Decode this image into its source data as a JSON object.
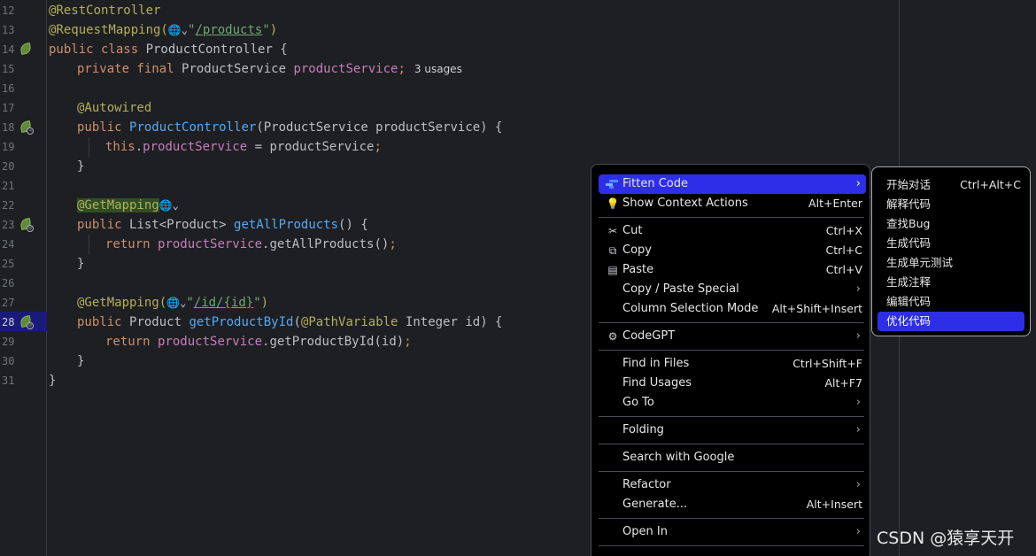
{
  "editor": {
    "line_numbers": [
      "12",
      "13",
      "14",
      "15",
      "16",
      "17",
      "18",
      "19",
      "20",
      "21",
      "22",
      "23",
      "24",
      "25",
      "26",
      "27",
      "28",
      "29",
      "30",
      "31"
    ],
    "active_line": "28",
    "code": {
      "l12": "@RestController",
      "l13_ann": "@RequestMapping(",
      "l13_globe": "🌐⌄",
      "l13_q1": "\"",
      "l13_url": "/products",
      "l13_q2": "\"",
      "l13_close": ")",
      "l14_kw": "public class ",
      "l14_name": "ProductController {",
      "l15_kw": "private final ",
      "l15_type": "ProductService ",
      "l15_field": "productService",
      "l15_semi": ";",
      "l15_hint": "3 usages",
      "l17": "@Autowired",
      "l18_kw": "public ",
      "l18_fn": "ProductController",
      "l18_rest": "(ProductService productService) {",
      "l19_kw": "this",
      "l19_dot": ".",
      "l19_field": "productService",
      "l19_rest": " = productService",
      "l19_semi": ";",
      "l20": "}",
      "l22_ann": "@GetMapping",
      "l22_globe": "🌐⌄",
      "l23_kw": "public ",
      "l23_type": "List<Product> ",
      "l23_fn": "getAllProducts",
      "l23_rest": "() {",
      "l24_kw": "return ",
      "l24_field": "productService",
      "l24_rest": ".getAllProducts()",
      "l24_semi": ";",
      "l25": "}",
      "l27_ann": "@GetMapping(",
      "l27_globe": "🌐⌄",
      "l27_q1": "\"",
      "l27_url": "/id/{id}",
      "l27_q2": "\"",
      "l27_close": ")",
      "l28_kw": "public ",
      "l28_type": "Product ",
      "l28_fn": "getProductById",
      "l28_p": "(",
      "l28_ann": "@PathVariable",
      "l28_rest": " Integer id) {",
      "l29_kw": "return ",
      "l29_field": "productService",
      "l29_rest": ".getProductById(id)",
      "l29_semi": ";",
      "l30": "}",
      "l31": "}"
    }
  },
  "context_menu": {
    "items": [
      {
        "label": "Fitten Code",
        "icon": "fitten-code-icon",
        "submenu": true
      },
      {
        "label": "Show Context Actions",
        "icon": "lightbulb-icon",
        "shortcut": "Alt+Enter"
      },
      {
        "label": "Cut",
        "icon": "scissors-icon",
        "shortcut": "Ctrl+X"
      },
      {
        "label": "Copy",
        "icon": "copy-icon",
        "shortcut": "Ctrl+C"
      },
      {
        "label": "Paste",
        "icon": "paste-icon",
        "shortcut": "Ctrl+V"
      },
      {
        "label": "Copy / Paste Special",
        "submenu": true
      },
      {
        "label": "Column Selection Mode",
        "shortcut": "Alt+Shift+Insert"
      },
      {
        "label": "CodeGPT",
        "icon": "codegpt-icon",
        "submenu": true
      },
      {
        "label": "Find in Files",
        "shortcut": "Ctrl+Shift+F"
      },
      {
        "label": "Find Usages",
        "shortcut": "Alt+F7"
      },
      {
        "label": "Go To",
        "submenu": true
      },
      {
        "label": "Folding",
        "submenu": true
      },
      {
        "label": "Search with Google"
      },
      {
        "label": "Refactor",
        "submenu": true
      },
      {
        "label": "Generate...",
        "shortcut": "Alt+Insert"
      },
      {
        "label": "Open In",
        "submenu": true
      }
    ]
  },
  "fitten_submenu": {
    "items": [
      {
        "label": "开始对话",
        "shortcut": "Ctrl+Alt+C"
      },
      {
        "label": "解释代码"
      },
      {
        "label": "查找Bug"
      },
      {
        "label": "生成代码"
      },
      {
        "label": "生成单元测试"
      },
      {
        "label": "生成注释"
      },
      {
        "label": "编辑代码"
      },
      {
        "label": "优化代码"
      }
    ]
  },
  "watermark": "CSDN @猿享天开",
  "colors": {
    "background": "#1e1f22",
    "selection": "#005f86",
    "menu_highlight": "#2e2ee8",
    "keyword": "#cf8e6d",
    "annotation": "#b3ae60",
    "function": "#56a8f5",
    "field": "#c77dbb",
    "string": "#6aab73"
  }
}
